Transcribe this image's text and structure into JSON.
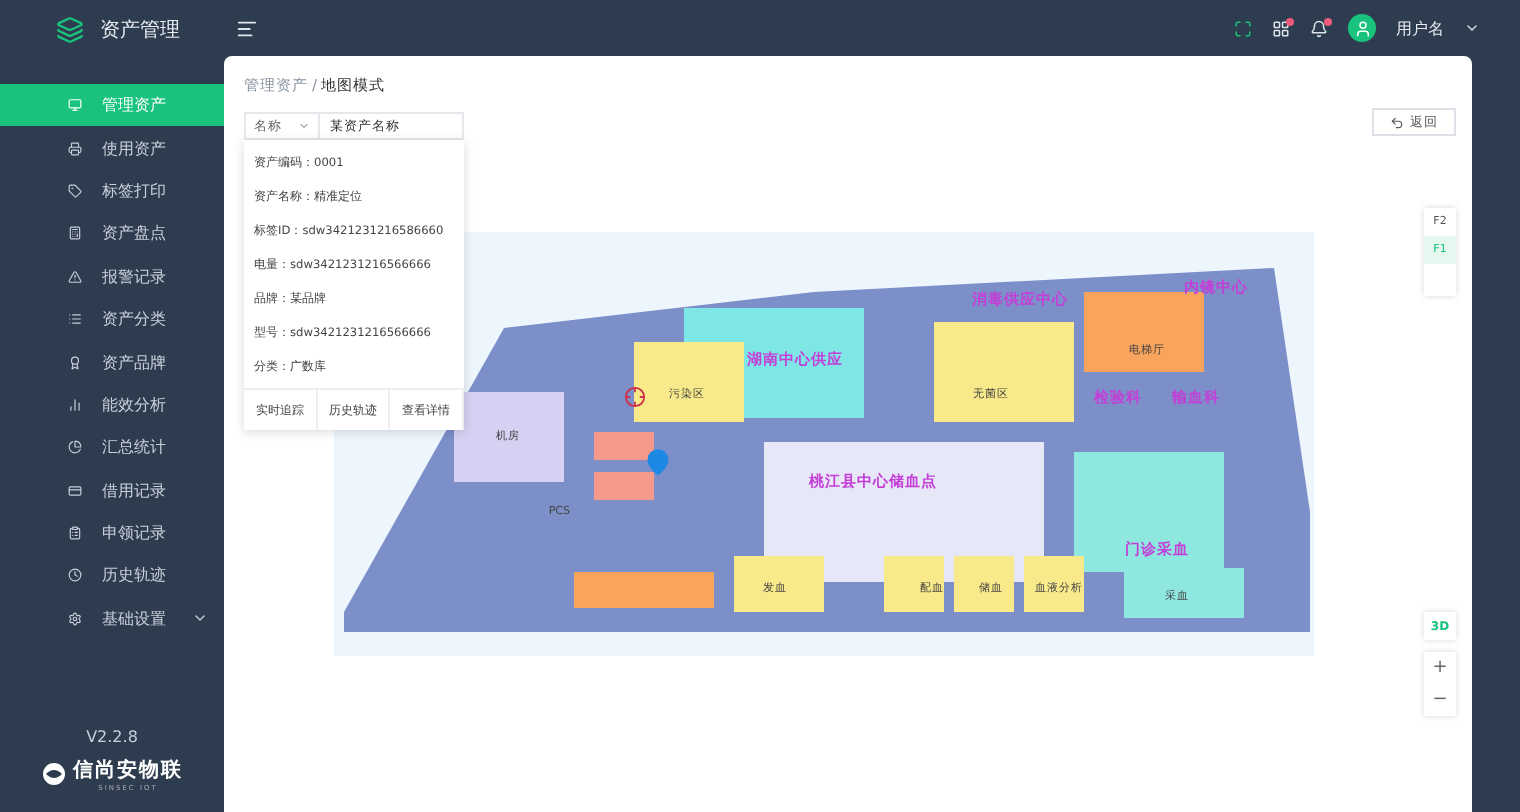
{
  "app": {
    "title": "资产管理",
    "version": "V2.2.8",
    "brand": "信尚安物联",
    "brand_sub": "SINSEC IOT"
  },
  "sidebar": {
    "items": [
      {
        "label": "管理资产",
        "selected": true
      },
      {
        "label": "使用资产",
        "selected": false
      },
      {
        "label": "标签打印",
        "selected": false
      },
      {
        "label": "资产盘点",
        "selected": false
      },
      {
        "label": "报警记录",
        "selected": false
      },
      {
        "label": "资产分类",
        "selected": false
      },
      {
        "label": "资产品牌",
        "selected": false
      },
      {
        "label": "能效分析",
        "selected": false
      },
      {
        "label": "汇总统计",
        "selected": false
      },
      {
        "label": "借用记录",
        "selected": false
      },
      {
        "label": "申领记录",
        "selected": false
      },
      {
        "label": "历史轨迹",
        "selected": false
      },
      {
        "label": "基础设置",
        "selected": false,
        "expanded": false
      }
    ]
  },
  "header": {
    "user": "用户名",
    "grid_badge": true,
    "bell_badge": true
  },
  "breadcrumb": {
    "items": [
      "管理资产",
      "地图模式"
    ],
    "separator": "/"
  },
  "search": {
    "field": "名称",
    "value": "某资产名称"
  },
  "asset_card": {
    "fields": [
      {
        "label": "资产编码：",
        "value": "0001"
      },
      {
        "label": "资产名称：",
        "value": "精准定位"
      },
      {
        "label": "标签ID：",
        "value": "sdw3421231216586660"
      },
      {
        "label": "电量：",
        "value": "sdw3421231216566666"
      },
      {
        "label": "品牌：",
        "value": "某品牌"
      },
      {
        "label": "型号：",
        "value": "sdw3421231216566666"
      },
      {
        "label": "分类：",
        "value": "广数库"
      }
    ],
    "actions": [
      "实时追踪",
      "历史轨迹",
      "查看详情"
    ]
  },
  "back_button": "返回",
  "floors": [
    {
      "label": "F2",
      "selected": false
    },
    {
      "label": "F1",
      "selected": true
    }
  ],
  "view_toggle": "3D",
  "zoom": [
    "+",
    "−"
  ],
  "map": {
    "rooms": [
      {
        "name": "湖南中心供应",
        "kind": "department"
      },
      {
        "name": "桃江县中心储血点",
        "kind": "department"
      },
      {
        "name": "消毒供应中心",
        "kind": "department"
      },
      {
        "name": "内镜中心",
        "kind": "department"
      },
      {
        "name": "检验科",
        "kind": "department"
      },
      {
        "name": "输血科",
        "kind": "department"
      },
      {
        "name": "门诊采血",
        "kind": "department"
      },
      {
        "name": "污染区",
        "kind": "room"
      },
      {
        "name": "无菌区",
        "kind": "room"
      },
      {
        "name": "机房",
        "kind": "room"
      },
      {
        "name": "电梯厅",
        "kind": "room"
      },
      {
        "name": "发血",
        "kind": "room"
      },
      {
        "name": "配血",
        "kind": "room"
      },
      {
        "name": "储血",
        "kind": "room"
      },
      {
        "name": "血液分析",
        "kind": "room"
      },
      {
        "name": "采血",
        "kind": "room"
      },
      {
        "name": "PCS",
        "kind": "room"
      }
    ]
  }
}
